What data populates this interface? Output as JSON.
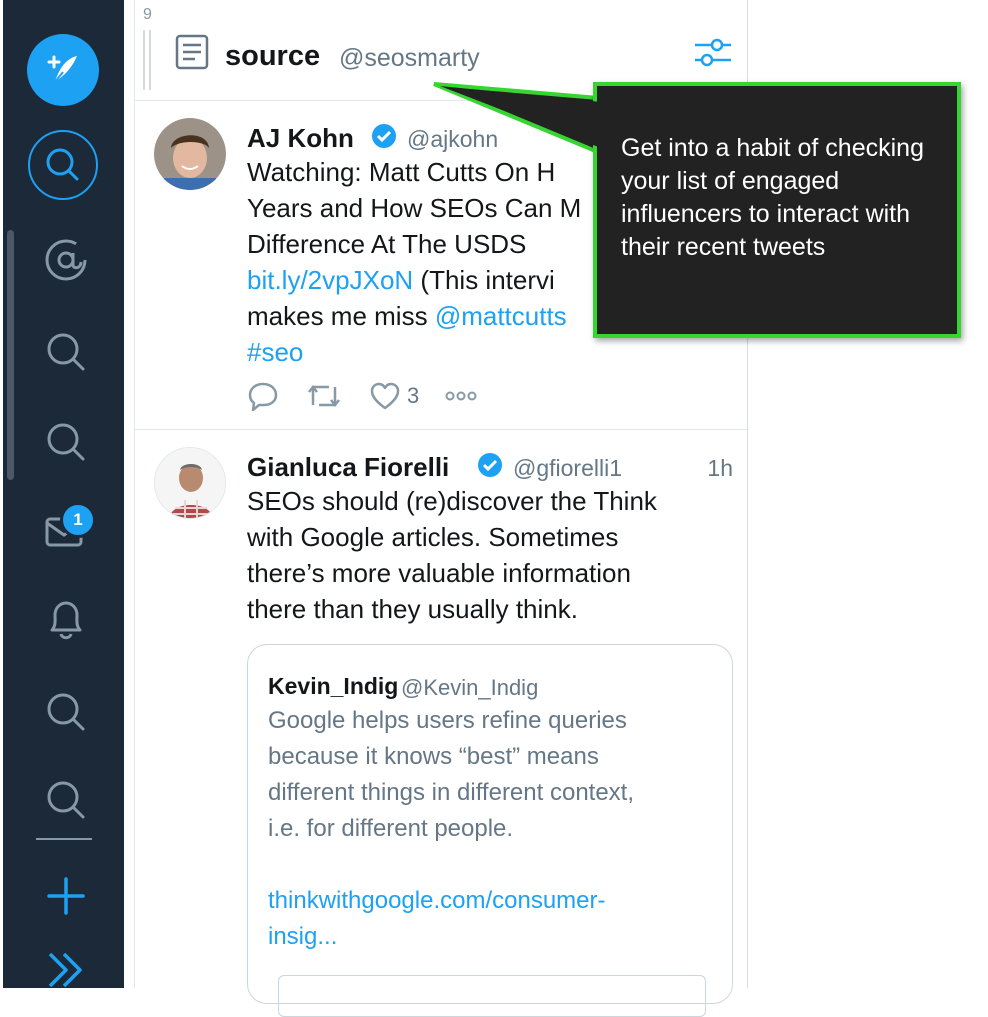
{
  "column": {
    "index": "9",
    "title": "source",
    "handle": "@seosmarty"
  },
  "sidebar": {
    "notification_badge": "1"
  },
  "tweets": [
    {
      "name": "AJ Kohn",
      "handle": "@ajkohn",
      "lines": [
        {
          "text": "Watching: Matt Cutts On H"
        },
        {
          "text": "Years and How SEOs Can M"
        },
        {
          "text": "Difference At The USDS"
        },
        {
          "link": "bit.ly/2vpJXoN",
          "text": " (This intervi"
        },
        {
          "text": "makes me miss ",
          "link": "@mattcutts"
        },
        {
          "link": "#seo"
        }
      ],
      "like_count": "3"
    },
    {
      "name": "Gianluca Fiorelli",
      "handle": "@gfiorelli1",
      "time": "1h",
      "lines": [
        "SEOs should (re)discover the Think",
        "with Google articles. Sometimes",
        "there’s more valuable information",
        "there than they usually think."
      ],
      "quote": {
        "name": "Kevin_Indig",
        "handle": "@Kevin_Indig",
        "lines": [
          "Google helps users refine queries",
          "because it knows “best” means",
          "different things in different context,",
          "i.e. for different people."
        ],
        "link_lines": [
          "thinkwithgoogle.com/consumer-",
          "insig..."
        ]
      }
    }
  ],
  "callout": {
    "text": "Get into a habit of checking your list of engaged influencers to interact with their recent tweets"
  },
  "colors": {
    "accent": "#1da1f2",
    "sidebar_bg": "#1c2938",
    "callout_border": "#37d531",
    "callout_bg": "#222222"
  }
}
